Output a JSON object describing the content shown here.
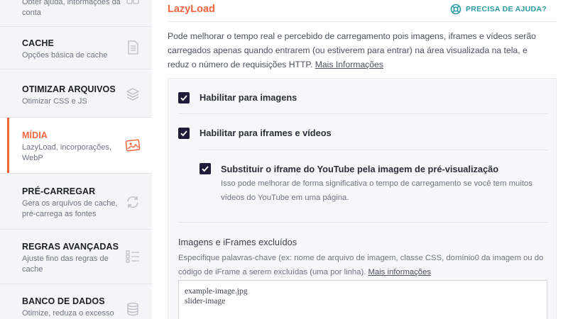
{
  "sidebar": {
    "items": [
      {
        "id": "account",
        "title": "",
        "desc": "Obter ajuda, informações da conta",
        "icon": "account-icon"
      },
      {
        "id": "cache",
        "title": "CACHE",
        "desc": "Opções básica de cache",
        "icon": "document-icon"
      },
      {
        "id": "files",
        "title": "OTIMIZAR ARQUIVOS",
        "desc": "Otimizar CSS e JS",
        "icon": "layers-icon"
      },
      {
        "id": "media",
        "title": "MÍDIA",
        "desc": "LazyLoad, incorporações, WebP",
        "icon": "image-icon",
        "active": true
      },
      {
        "id": "preload",
        "title": "PRÉ-CARREGAR",
        "desc": "Gera os arquivos de cache, pré-carrega as fontes",
        "icon": "refresh-icon"
      },
      {
        "id": "rules",
        "title": "REGRAS AVANÇADAS",
        "desc": "Ajuste fino das regras de cache",
        "icon": "list-icon"
      },
      {
        "id": "database",
        "title": "BANCO DE DADOS",
        "desc": "Otimize, reduza o excesso",
        "icon": "database-icon"
      }
    ]
  },
  "main": {
    "section_title": "LazyLoad",
    "help_label": "PRECISA DE AJUDA?",
    "intro_text": "Pode melhorar o tempo real e percebido de carregamento pois imagens, iframes e vídeos serão carregados apenas quando entrarem (ou estiverem para entrar) na área visualizada na tela, e reduz o número de requisições HTTP.",
    "intro_link": "Mais Informações",
    "options": {
      "images": {
        "label": "Habilitar para imagens",
        "checked": true
      },
      "iframes": {
        "label": "Habilitar para iframes e vídeos",
        "checked": true
      },
      "youtube": {
        "label": "Substituir o iframe do YouTube pela imagem de pré-visualização",
        "checked": true,
        "desc": "Isso pode melhorar de forma significativa o tempo de carregamento se você tem muitos vídeos do YouTube em uma página."
      }
    },
    "excluded": {
      "title": "Imagens e iFrames excluídos",
      "desc": "Especifique palavras-chave (ex: nome de arquivo de imagem, classe CSS, domínio0 da imagem ou do código de iFrame a serem excluídas (uma por linha).",
      "link": "Mais informações",
      "value": "example-image.jpg\nslider-image"
    }
  },
  "colors": {
    "accent": "#f56640",
    "help": "#2a9aa3",
    "checkbox": "#1f1c3a"
  }
}
